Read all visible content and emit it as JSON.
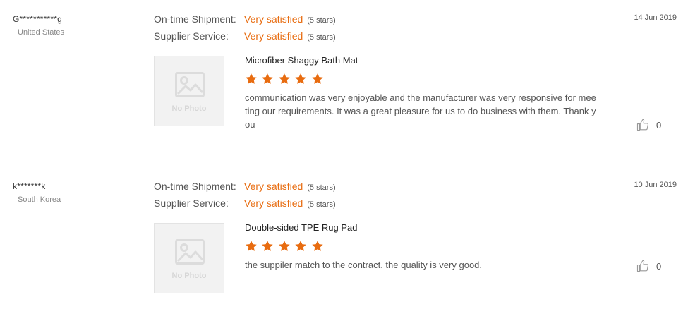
{
  "labels": {
    "ontime": "On-time Shipment:",
    "service": "Supplier Service:",
    "no_photo": "No Photo"
  },
  "accent_color": "#e86c10",
  "reviews": [
    {
      "buyer": "G***********g",
      "country": "United States",
      "date": "14 Jun 2019",
      "ontime_value": "Very satisfied",
      "ontime_stars": "(5 stars)",
      "service_value": "Very satisfied",
      "service_stars": "(5 stars)",
      "product": "Microfiber Shaggy Bath Mat",
      "rating": 5,
      "comment": "communication was very enjoyable and the manufacturer was very responsive  for meeting our requirements. It was a great pleasure for us to do business with them. Thank you",
      "likes": "0"
    },
    {
      "buyer": "k*******k",
      "country": "South Korea",
      "date": "10 Jun 2019",
      "ontime_value": "Very satisfied",
      "ontime_stars": "(5 stars)",
      "service_value": "Very satisfied",
      "service_stars": "(5 stars)",
      "product": "Double-sided TPE Rug Pad",
      "rating": 5,
      "comment": "the suppiler match to the contract. the quality is very good.",
      "likes": "0"
    }
  ]
}
